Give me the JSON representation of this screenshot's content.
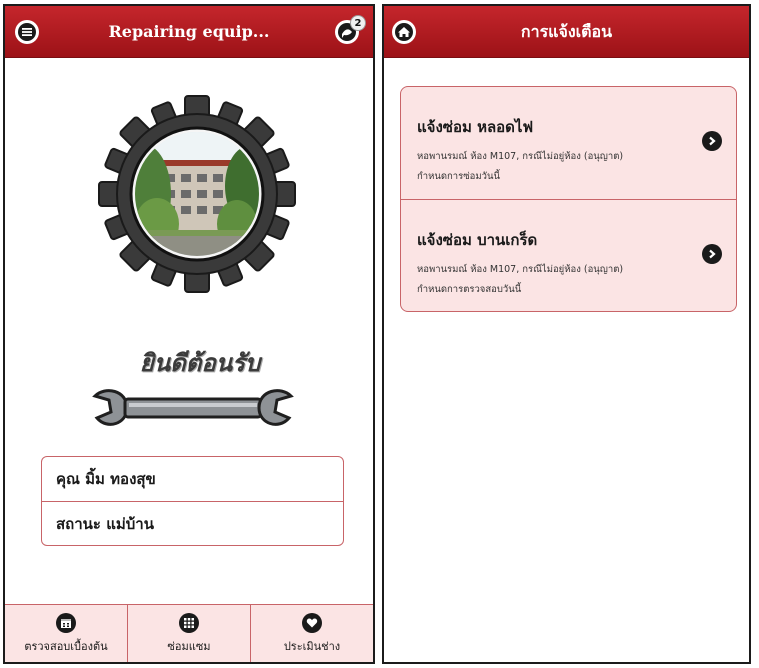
{
  "left_screen": {
    "header": {
      "title": "Repairing equip...",
      "menu_icon": "menu-icon",
      "notification_icon": "chat-icon",
      "notification_count": "2"
    },
    "welcome_text": "ยินดีต้อนรับ",
    "user": {
      "name": "คุณ มิ้ม ทองสุข",
      "status": "สถานะ แม่บ้าน"
    },
    "tabs": [
      {
        "label": "ตรวจสอบเบื้องต้น",
        "icon": "calendar-icon"
      },
      {
        "label": "ซ่อมแซม",
        "icon": "grid-icon"
      },
      {
        "label": "ประเมินช่าง",
        "icon": "heart-icon"
      }
    ]
  },
  "right_screen": {
    "header": {
      "title": "การแจ้งเตือน",
      "home_icon": "home-icon"
    },
    "notifications": [
      {
        "title": "แจ้งซ่อม หลอดไฟ",
        "location": "หอพานรมณ์ ห้อง M107, กรณีไม่อยู่ห้อง (อนุญาต)",
        "note": "กำหนดการซ่อมวันนี้"
      },
      {
        "title": "แจ้งซ่อม บานเกร็ด",
        "location": "หอพานรมณ์ ห้อง M107, กรณีไม่อยู่ห้อง (อนุญาต)",
        "note": "กำหนดการตรวจสอบวันนี้"
      }
    ]
  },
  "colors": {
    "header_red": "#b71c1c",
    "row_pink": "#fbe4e4",
    "border_red": "#c86468"
  }
}
